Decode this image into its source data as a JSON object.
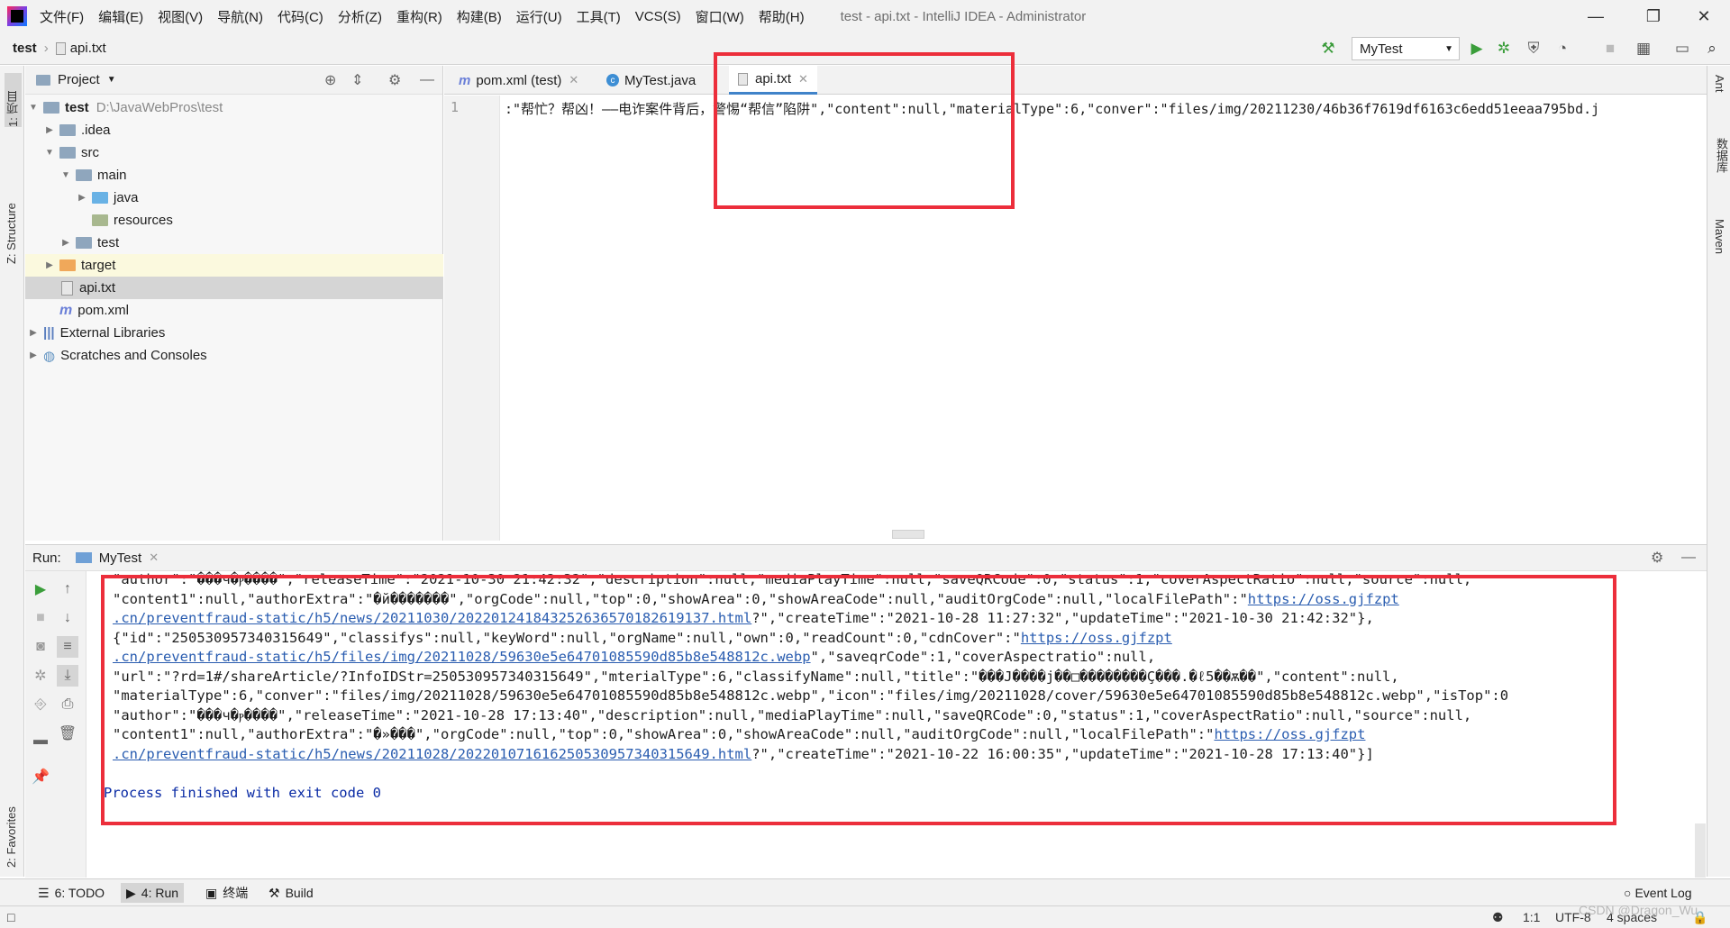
{
  "titlebar": {
    "menus": [
      "文件(F)",
      "编辑(E)",
      "视图(V)",
      "导航(N)",
      "代码(C)",
      "分析(Z)",
      "重构(R)",
      "构建(B)",
      "运行(U)",
      "工具(T)",
      "VCS(S)",
      "窗口(W)",
      "帮助(H)"
    ],
    "window_title": "test - api.txt - IntelliJ IDEA - Administrator"
  },
  "navbar": {
    "project": "test",
    "file": "api.txt",
    "run_config": "MyTest"
  },
  "left_stripe": {
    "project_label": "1: 项目",
    "structure_label": "Z: Structure",
    "favorites_label": "2: Favorites"
  },
  "right_stripe": {
    "ant_label": "Ant",
    "db_label": "数据库",
    "maven_label": "Maven"
  },
  "project_panel": {
    "title": "Project",
    "tree": [
      {
        "label": "test",
        "path": "D:\\JavaWebPros\\test"
      },
      {
        "label": ".idea"
      },
      {
        "label": "src"
      },
      {
        "label": "main"
      },
      {
        "label": "java"
      },
      {
        "label": "resources"
      },
      {
        "label": "test"
      },
      {
        "label": "target"
      },
      {
        "label": "api.txt"
      },
      {
        "label": "pom.xml"
      },
      {
        "label": "External Libraries"
      },
      {
        "label": "Scratches and Consoles"
      }
    ]
  },
  "editor": {
    "tabs": [
      "pom.xml (test)",
      "MyTest.java",
      "api.txt"
    ],
    "line_number": "1",
    "code_line": ":\"帮忙？帮凶！——电诈案件背后，警惕“帮信”陷阱\",\"content\":null,\"materialType\":6,\"conver\":\"files/img/20211230/46b36f7619df6163c6edd51eeaa795bd.j"
  },
  "run": {
    "label": "Run:",
    "tab": "MyTest",
    "console": [
      {
        "text": "\"author\":\"���ч�ⲣ����\",\"releaseTime\":\"2021-10-30 21:42:32\",\"description\":null,\"mediaPlayTime\":null,\"saveQRCode\":0,\"status\":1,\"coverAspectRatio\":null,\"source\":null,"
      },
      {
        "pre": "\"content1\":null,\"authorExtra\":\"�й�������\",\"orgCode\":null,\"top\":0,\"showArea\":0,\"showAreaCode\":null,\"auditOrgCode\":null,\"localFilePath\":\"",
        "link": "https://oss.gjfzpt"
      },
      {
        "link": ".cn/preventfraud-static/h5/news/20211030/20220124184325263657018261913​7.html",
        "post": "?\",\"createTime\":\"2021-10-28 11:27:32\",\"updateTime\":\"2021-10-30 21:42:32\"},"
      },
      {
        "pre": "{\"id\":\"250530957340315649\",\"classifys\":null,\"keyWord\":null,\"orgName\":null,\"own\":0,\"readCount\":0,\"cdnCover\":\"",
        "link": "https://oss.gjfzpt"
      },
      {
        "link": ".cn/preventfraud-static/h5/files/img/20211028/59630e5e64701085590d85b8e548812c.webp",
        "post": "\",\"saveqrCode\":1,\"coverAspectratio\":null,"
      },
      {
        "text": "\"url\":\"?rd=1#/shareArticle/?InfoIDStr=250530957340315649\",\"mterialType\":6,\"classifyName\":null,\"title\":\"���Ј����ј��□��������Ç���.�ℓ5��ѫ��\",\"content\":null,"
      },
      {
        "text": "\"materialType\":6,\"conver\":\"files/img/20211028/59630e5e64701085590d85b8e548812c.webp\",\"icon\":\"files/img/20211028/cover/59630e5e64701085590d85b8e548812c.webp\",\"isTop\":0"
      },
      {
        "text": "\"author\":\"���ч�ⲣ����\",\"releaseTime\":\"2021-10-28 17:13:40\",\"description\":null,\"mediaPlayTime\":null,\"saveQRCode\":0,\"status\":1,\"coverAspectRatio\":null,\"source\":null,"
      },
      {
        "pre": "\"content1\":null,\"authorExtra\":\"�»���\",\"orgCode\":null,\"top\":0,\"showArea\":0,\"showAreaCode\":null,\"auditOrgCode\":null,\"localFilePath\":\"",
        "link": "https://oss.gjfzpt"
      },
      {
        "link": ".cn/preventfraud-static/h5/news/20211028/20220107161625053095734031564​9.html",
        "post": "?\",\"createTime\":\"2021-10-22 16:00:35\",\"updateTime\":\"2021-10-28 17:13:40\"}]"
      }
    ],
    "exit": "Process finished with exit code 0"
  },
  "bottom_tools": [
    "6: TODO",
    "4: Run",
    "终端",
    "Build",
    "Event Log"
  ],
  "status": {
    "position": "1:1",
    "encoding": "UTF-8",
    "indent": "4 spaces",
    "watermark": "CSDN @Dragon_Wu"
  },
  "colors": {
    "highlight_box": "#ec2e3b",
    "link": "#2a5db0",
    "exit_text": "#0a2ba5",
    "selection": "#d5d5d5"
  }
}
